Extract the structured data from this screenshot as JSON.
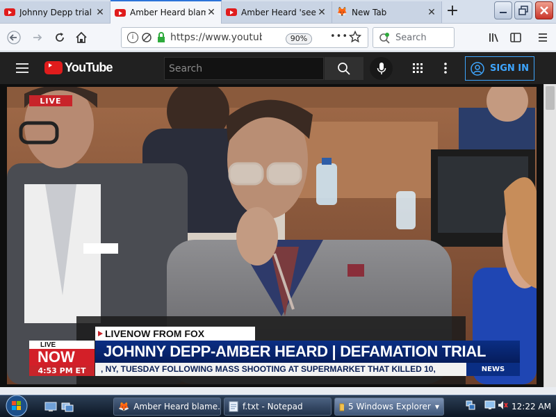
{
  "browser": {
    "tabs": [
      {
        "title": "Johnny Depp trial",
        "favicon": "youtube-icon",
        "active": false
      },
      {
        "title": "Amber Heard blam",
        "favicon": "youtube-icon",
        "active": true
      },
      {
        "title": "Amber Heard 'seei",
        "favicon": "youtube-icon",
        "active": false
      },
      {
        "title": "New Tab",
        "favicon": "firefox-icon",
        "active": false
      }
    ],
    "new_tab_label": "+",
    "url": "https://www.youtube",
    "zoom": "90%",
    "search_placeholder": "Search",
    "more_label": "•••"
  },
  "youtube": {
    "logo_text": "YouTube",
    "search_placeholder": "Search",
    "sign_in_label": "SIGN IN"
  },
  "video": {
    "live_badge": "LIVE",
    "chyron_source": "LIVENOW FROM FOX",
    "headline": "JOHNNY DEPP-AMBER HEARD | DEFAMATION TRIAL",
    "ticker": ", NY, TUESDAY FOLLOWING MASS SHOOTING AT SUPERMARKET THAT KILLED 10,",
    "news_tag": "NEWS",
    "logo_small": "LIVE",
    "logo_big": "NOW",
    "time": "4:53 PM ET"
  },
  "taskbar": {
    "items": [
      {
        "label": "Amber Heard blame...",
        "icon": "firefox-icon",
        "active": false
      },
      {
        "label": "f.txt - Notepad",
        "icon": "notepad-icon",
        "active": false
      },
      {
        "label": "5 Windows Explorer",
        "icon": "folder-icon",
        "active": true
      }
    ],
    "clock": "12:22 AM"
  },
  "colors": {
    "youtube_red": "#e01c1c",
    "youtube_header": "#212121",
    "signin_blue": "#3ea6ff",
    "fox_red": "#c8242a",
    "fox_blue": "#0a2e84"
  }
}
